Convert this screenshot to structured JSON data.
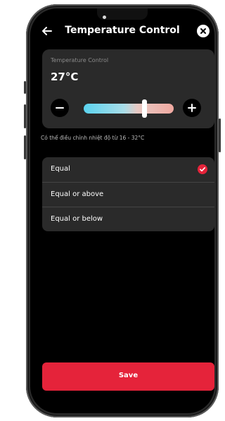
{
  "header": {
    "title": "Temperature Control"
  },
  "temperature": {
    "label": "Temperature Control",
    "value": "27°C",
    "min": 16,
    "max": 32,
    "current": 27,
    "hint": "Có thể điều chỉnh nhiệt độ từ 16 - 32°C"
  },
  "options": [
    {
      "label": "Equal",
      "selected": true
    },
    {
      "label": "Equal or above",
      "selected": false
    },
    {
      "label": "Equal or below",
      "selected": false
    }
  ],
  "footer": {
    "save_label": "Save"
  },
  "colors": {
    "accent": "#e5233a",
    "card": "#2a2a2a",
    "background": "#000000",
    "slider_cold": "#5bd3ee",
    "slider_warm": "#f0a8a0"
  },
  "icons": {
    "back": "arrow-left-icon",
    "close": "close-icon",
    "minus": "minus-icon",
    "plus": "plus-icon",
    "check": "check-icon"
  }
}
